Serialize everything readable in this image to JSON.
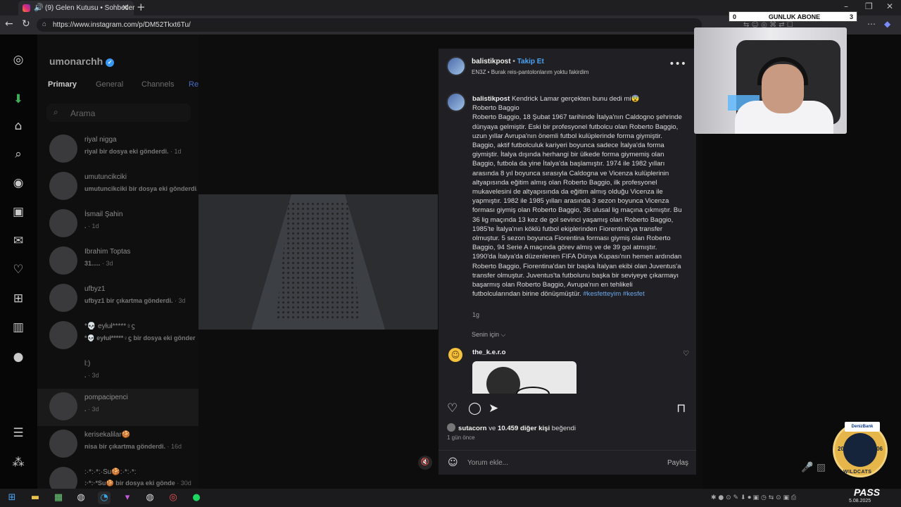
{
  "browser": {
    "tab_title": "(9) Gelen Kutusu • Sohbetler",
    "url": "https://www.instagram.com/p/DM52Tkxt6Tu/"
  },
  "overlay": {
    "left_count": "0",
    "label": "GUNLUK ABONE",
    "right_count": "3"
  },
  "inbox": {
    "username": "umonarchh",
    "tabs": [
      "Primary",
      "General",
      "Channels",
      "Re"
    ],
    "search_placeholder": "Arama",
    "conversations": [
      {
        "name": "riyal nigga",
        "msg": "riyal bir dosya eki gönderdi.",
        "time": " · 1d"
      },
      {
        "name": "umutuncikciki",
        "msg": "umutuncikciki bir dosya eki gönderdi.",
        "time": ""
      },
      {
        "name": "İsmail Şahin",
        "msg": ".",
        "time": " · 1d"
      },
      {
        "name": "Ibrahim Toptas",
        "msg": "31.....",
        "time": " · 3d"
      },
      {
        "name": "ufbyz1",
        "msg": "ufbyz1 bir çıkartma gönderdi.",
        "time": " · 3d"
      },
      {
        "name": "*💀 eyłuł*****♀ϛ",
        "msg": "*💀 eyłuł*****♀ϛ bir dosya eki gönder",
        "time": ""
      },
      {
        "name": "l:)",
        "msg": ".",
        "time": " · 3d"
      },
      {
        "name": "pompacipenci",
        "msg": ".",
        "time": " · 3d"
      },
      {
        "name": "kerisekalilar🍪",
        "msg": "nisa bir çıkartma gönderdi.",
        "time": " · 16d"
      },
      {
        "name": ":·*:·*:·Su🍪:·*:·*:",
        "msg": ":·*:·*Su🍪 bir dosya eki gönde",
        "time": " · 30d"
      }
    ]
  },
  "post": {
    "author": "balistikpost",
    "follow": "Takip Et",
    "subtitle": "EN3Z • Burak reis-pantolonlarım yoktu fakirdim",
    "caption_user": "balistikpost",
    "caption_first": "Kendrick Lamar gerçekten bunu dedi mi😨",
    "caption_body": "Roberto Baggio\nRoberto Baggio, 18 Şubat 1967 tarihinde İtalya'nın Caldogno şehrinde dünyaya gelmiştir. Eski bir profesyonel futbolcu olan Roberto Baggio, uzun yıllar Avrupa'nın önemli futbol kulüplerinde forma giymiştir. Baggio, aktif futbolculuk kariyeri boyunca sadece İtalya'da forma giymiştir. İtalya dışında herhangi bir ülkede forma giymemiş olan Baggio, futbola da yine İtalya'da başlamıştır. 1974 ile 1982 yılları arasında 8 yıl boyunca sırasıyla Caldogna ve Vicenza kulüplerinin altyapısında eğitim almış olan Roberto Baggio, ilk profesyonel mukavelesini de altyapısında da eğitim almış olduğu Vicenza ile yapmıştır. 1982 ile 1985 yılları arasında 3 sezon boyunca Vicenza forması giymiş olan Roberto Baggio, 36 ulusal lig maçına çıkmıştır. Bu 36 lig maçında 13 kez de gol sevinci yaşamış olan Roberto Baggio, 1985'te İtalya'nın köklü futbol ekiplerinden Fiorentina'ya transfer olmuştur. 5 sezon boyunca Fiorentina forması giymiş olan Roberto Baggio, 94 Serie A maçında görev almış ve de 39 gol atmıştır. 1990'da İtalya'da düzenlenen FIFA Dünya Kupası'nın hemen ardından Roberto Baggio, Fiorentina'dan bir başka İtalyan ekibi olan Juventus'a transfer olmuştur. Juventus'ta futbolunu başka bir seviyeye çıkarmayı başarmış olan Roberto Baggio, Avrupa'nın en tehlikeli futbolcularından birine dönüşmüştür.",
    "hashtags": "#kesfetteyim #kesfet",
    "caption_age": "1g",
    "for_you": "Senin için ⌵",
    "comment_user": "the_k.e.r.o",
    "liked_by": "sutacorn",
    "likes_joiner": " ve ",
    "likes_count": "10.459 diğer kişi",
    "likes_suffix": " beğendi",
    "posted_ago": "1 gün önce",
    "comment_placeholder": "Yorum ekle...",
    "share_label": "Paylaş"
  },
  "badge": {
    "sponsor": "DenizBank",
    "year_left": "20",
    "year_right": "06",
    "team": "WILDCATS"
  },
  "taskbar": {
    "pass_label": "PASS",
    "date": "5.08.2025"
  },
  "icons": [
    "instagram-icon",
    "download-icon",
    "home-icon",
    "search-icon",
    "explore-icon",
    "reels-icon",
    "messages-icon",
    "heart-icon",
    "create-icon",
    "dashboard-icon",
    "profile-icon",
    "menu-icon",
    "more-icon"
  ]
}
